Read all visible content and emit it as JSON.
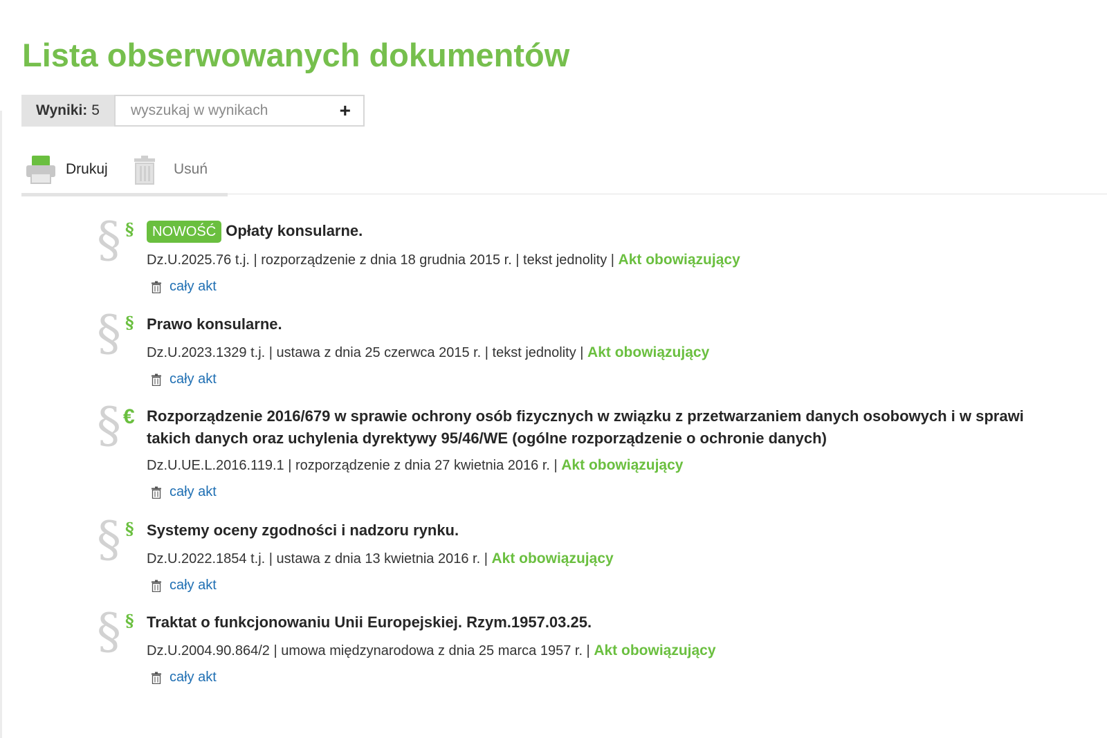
{
  "page": {
    "title": "Lista obserwowanych dokumentów"
  },
  "results": {
    "label": "Wyniki:",
    "count": "5",
    "search_placeholder": "wyszukaj w wynikach"
  },
  "toolbar": {
    "print_label": "Drukuj",
    "delete_label": "Usuń"
  },
  "colors": {
    "accent": "#76bf4d",
    "link": "#1f6fb3",
    "icon_gray": "#d2d2d2"
  },
  "documents": [
    {
      "type_icon": "paragraph-icon",
      "badge": "NOWOŚĆ",
      "title": "Opłaty konsularne.",
      "meta": "Dz.U.2025.76 t.j. | rozporządzenie z dnia 18 grudnia 2015 r. | tekst jednolity |",
      "status": "Akt obowiązujący",
      "action": "cały akt"
    },
    {
      "type_icon": "paragraph-icon",
      "title": "Prawo konsularne.",
      "meta": "Dz.U.2023.1329 t.j. | ustawa z dnia 25 czerwca 2015 r. | tekst jednolity |",
      "status": "Akt obowiązujący",
      "action": "cały akt"
    },
    {
      "type_icon": "euro-icon",
      "title_line1": "Rozporządzenie 2016/679 w sprawie ochrony osób fizycznych w związku z przetwarzaniem danych osobowych i w sprawi",
      "title_line2": "takich danych oraz uchylenia dyrektywy 95/46/WE (ogólne rozporządzenie o ochronie danych)",
      "meta": "Dz.U.UE.L.2016.119.1 | rozporządzenie z dnia 27 kwietnia 2016 r. |",
      "status": "Akt obowiązujący",
      "action": "cały akt"
    },
    {
      "type_icon": "paragraph-icon",
      "title": "Systemy oceny zgodności i nadzoru rynku.",
      "meta": "Dz.U.2022.1854 t.j. | ustawa z dnia 13 kwietnia 2016 r. |",
      "status": "Akt obowiązujący",
      "action": "cały akt"
    },
    {
      "type_icon": "paragraph-icon",
      "title": "Traktat o funkcjonowaniu Unii Europejskiej. Rzym.1957.03.25.",
      "meta": "Dz.U.2004.90.864/2 | umowa międzynarodowa z dnia 25 marca 1957 r. |",
      "status": "Akt obowiązujący",
      "action": "cały akt"
    }
  ]
}
